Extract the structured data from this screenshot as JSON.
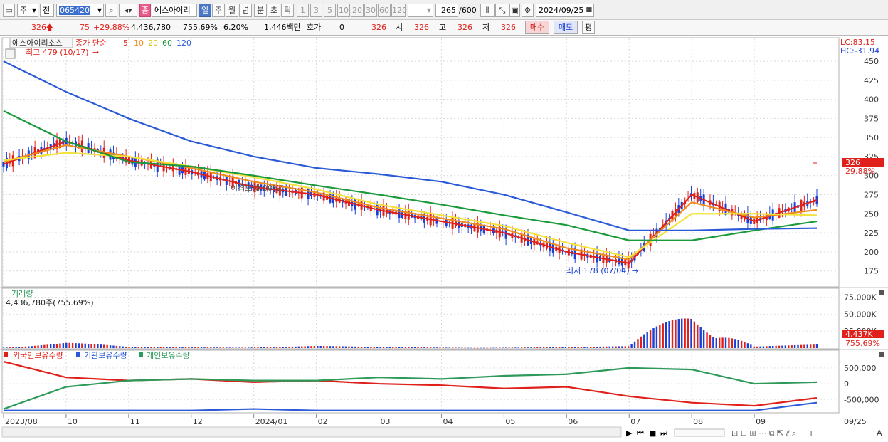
{
  "toolbar": {
    "period_type": "주",
    "period_type2": "전",
    "stock_code": "065420",
    "stock_name_badge": "종",
    "stock_name": "에스아이리",
    "intervals": [
      "일",
      "주",
      "월",
      "년",
      "분",
      "초",
      "틱"
    ],
    "active_interval": "일",
    "minute_options": [
      "1",
      "3",
      "5",
      "10",
      "20",
      "30",
      "60",
      "120"
    ],
    "count_value": "265",
    "count_max": "/600",
    "date": "2024/09/25"
  },
  "quote": {
    "price": "326",
    "change": "75",
    "change_pct": "+29.88%",
    "volume": "4,436,780",
    "volume_pct": "755.69%",
    "turnover_rate": "6.20%",
    "trade_value": "1,446백만",
    "hoga_label": "호가",
    "hoga_value": "0",
    "hoga_price": "326",
    "open_label": "시",
    "open": "326",
    "high_label": "고",
    "high": "326",
    "low_label": "저",
    "low": "326",
    "buy_label": "매수",
    "sell_label": "매도",
    "eval_label": "평"
  },
  "price_pane": {
    "legend_name": "에스아이리소스",
    "legend_type": "종가 단순",
    "ma_labels": [
      "5",
      "10",
      "20",
      "60",
      "120"
    ],
    "high_note": "최고 479 (10/17)",
    "low_note": "최저 178 (07/04)",
    "disparity_note": "이격도(0.00%)",
    "lc": "LC:83.15",
    "hc": "HC:-31.94",
    "current_price_tag": "326",
    "current_pct_tag": "29.88%"
  },
  "volume_pane": {
    "title": "거래량",
    "value_text": "4,436,780주(755.69%)",
    "current_tag": "4,437K",
    "current_pct": "755.69%"
  },
  "holder_pane": {
    "legend": [
      "외국인보유수량",
      "기관보유수량",
      "개인보유수량"
    ]
  },
  "x_axis": {
    "labels": [
      "2023/08",
      "10",
      "11",
      "12",
      "2024/01",
      "02",
      "03",
      "04",
      "05",
      "06",
      "07",
      "08",
      "09"
    ],
    "right_label": "09/25"
  },
  "chart_data": [
    {
      "type": "line",
      "title": "에스아이리소스 종가 단순 이동평균",
      "y_ticks": [
        175,
        200,
        225,
        250,
        275,
        300,
        325,
        350,
        375,
        400,
        425,
        450
      ],
      "ylim": [
        155,
        480
      ],
      "x": [
        "2023/08",
        "10",
        "11",
        "12",
        "2024/01",
        "02",
        "03",
        "04",
        "05",
        "06",
        "07",
        "08",
        "09",
        "09/25"
      ],
      "series": [
        {
          "name": "5",
          "color": "#e0201a",
          "values": [
            315,
            345,
            320,
            305,
            285,
            275,
            255,
            240,
            225,
            200,
            185,
            275,
            240,
            268
          ]
        },
        {
          "name": "10",
          "color": "#f08c1e",
          "values": [
            318,
            340,
            325,
            310,
            292,
            278,
            258,
            244,
            230,
            205,
            190,
            265,
            245,
            255
          ]
        },
        {
          "name": "20",
          "color": "#f2e23a",
          "values": [
            320,
            330,
            325,
            312,
            298,
            282,
            262,
            248,
            234,
            212,
            193,
            250,
            250,
            248
          ]
        },
        {
          "name": "60",
          "color": "#1a9a3a",
          "values": [
            385,
            345,
            318,
            312,
            300,
            287,
            275,
            262,
            248,
            235,
            215,
            215,
            228,
            240
          ]
        },
        {
          "name": "120",
          "color": "#2a5ad8",
          "values": [
            450,
            410,
            375,
            345,
            325,
            310,
            302,
            292,
            275,
            252,
            228,
            228,
            230,
            231
          ]
        }
      ],
      "annotations": {
        "max": {
          "value": 479,
          "date": "10/17"
        },
        "min": {
          "value": 178,
          "date": "07/04"
        },
        "last": 326
      }
    },
    {
      "type": "bar",
      "title": "거래량",
      "y_ticks": [
        "25,000K",
        "50,000K",
        "75,000K"
      ],
      "ylim": [
        0,
        85000
      ],
      "x": [
        "2023/08",
        "10",
        "11",
        "12",
        "2024/01",
        "02",
        "03",
        "04",
        "05",
        "06",
        "07",
        "08",
        "09",
        "09/25"
      ],
      "values": [
        2000,
        8000,
        1500,
        1200,
        1800,
        3000,
        1200,
        1000,
        900,
        1100,
        2500,
        75000,
        3000,
        4437
      ]
    },
    {
      "type": "line",
      "title": "보유수량",
      "y_ticks": [
        "500,000",
        "0",
        "-500,000"
      ],
      "ylim": [
        -900000,
        700000
      ],
      "x": [
        "2023/08",
        "10",
        "11",
        "12",
        "2024/01",
        "02",
        "03",
        "04",
        "05",
        "06",
        "07",
        "08",
        "09",
        "09/25"
      ],
      "series": [
        {
          "name": "외국인보유수량",
          "color": "#e0201a",
          "values": [
            700000,
            200000,
            100000,
            150000,
            50000,
            100000,
            0,
            -50000,
            -150000,
            -100000,
            -400000,
            -600000,
            -700000,
            -450000
          ]
        },
        {
          "name": "기관보유수량",
          "color": "#2a5ad8",
          "values": [
            -850000,
            -850000,
            -850000,
            -850000,
            -800000,
            -850000,
            -850000,
            -850000,
            -850000,
            -850000,
            -850000,
            -850000,
            -850000,
            -600000
          ]
        },
        {
          "name": "개인보유수량",
          "color": "#2e9a5a",
          "values": [
            -800000,
            -100000,
            100000,
            150000,
            100000,
            100000,
            200000,
            150000,
            250000,
            300000,
            500000,
            450000,
            0,
            50000
          ]
        }
      ]
    }
  ]
}
